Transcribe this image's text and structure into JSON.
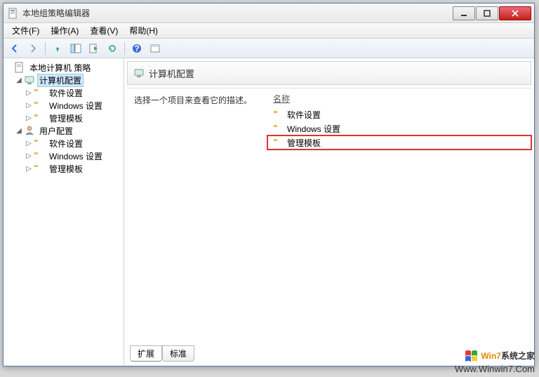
{
  "window": {
    "title": "本地组策略编辑器"
  },
  "menu": {
    "file": "文件(F)",
    "action": "操作(A)",
    "view": "查看(V)",
    "help": "帮助(H)"
  },
  "toolbar_icons": [
    "back",
    "forward",
    "up",
    "show-hide-tree",
    "export",
    "refresh",
    "help",
    "properties"
  ],
  "tree": {
    "root": "本地计算机 策略",
    "computer": {
      "label": "计算机配置",
      "children": [
        "软件设置",
        "Windows 设置",
        "管理模板"
      ]
    },
    "user": {
      "label": "用户配置",
      "children": [
        "软件设置",
        "Windows 设置",
        "管理模板"
      ]
    }
  },
  "content": {
    "header_title": "计算机配置",
    "description_prompt": "选择一个项目来查看它的描述。",
    "column_name": "名称",
    "items": [
      "软件设置",
      "Windows 设置",
      "管理模板"
    ],
    "highlighted_index": 2
  },
  "tabs": {
    "extended": "扩展",
    "standard": "标准"
  },
  "watermark": {
    "brand_pre": "Win7",
    "brand_post": "系统之家",
    "url": "Www.Winwin7.Com"
  }
}
